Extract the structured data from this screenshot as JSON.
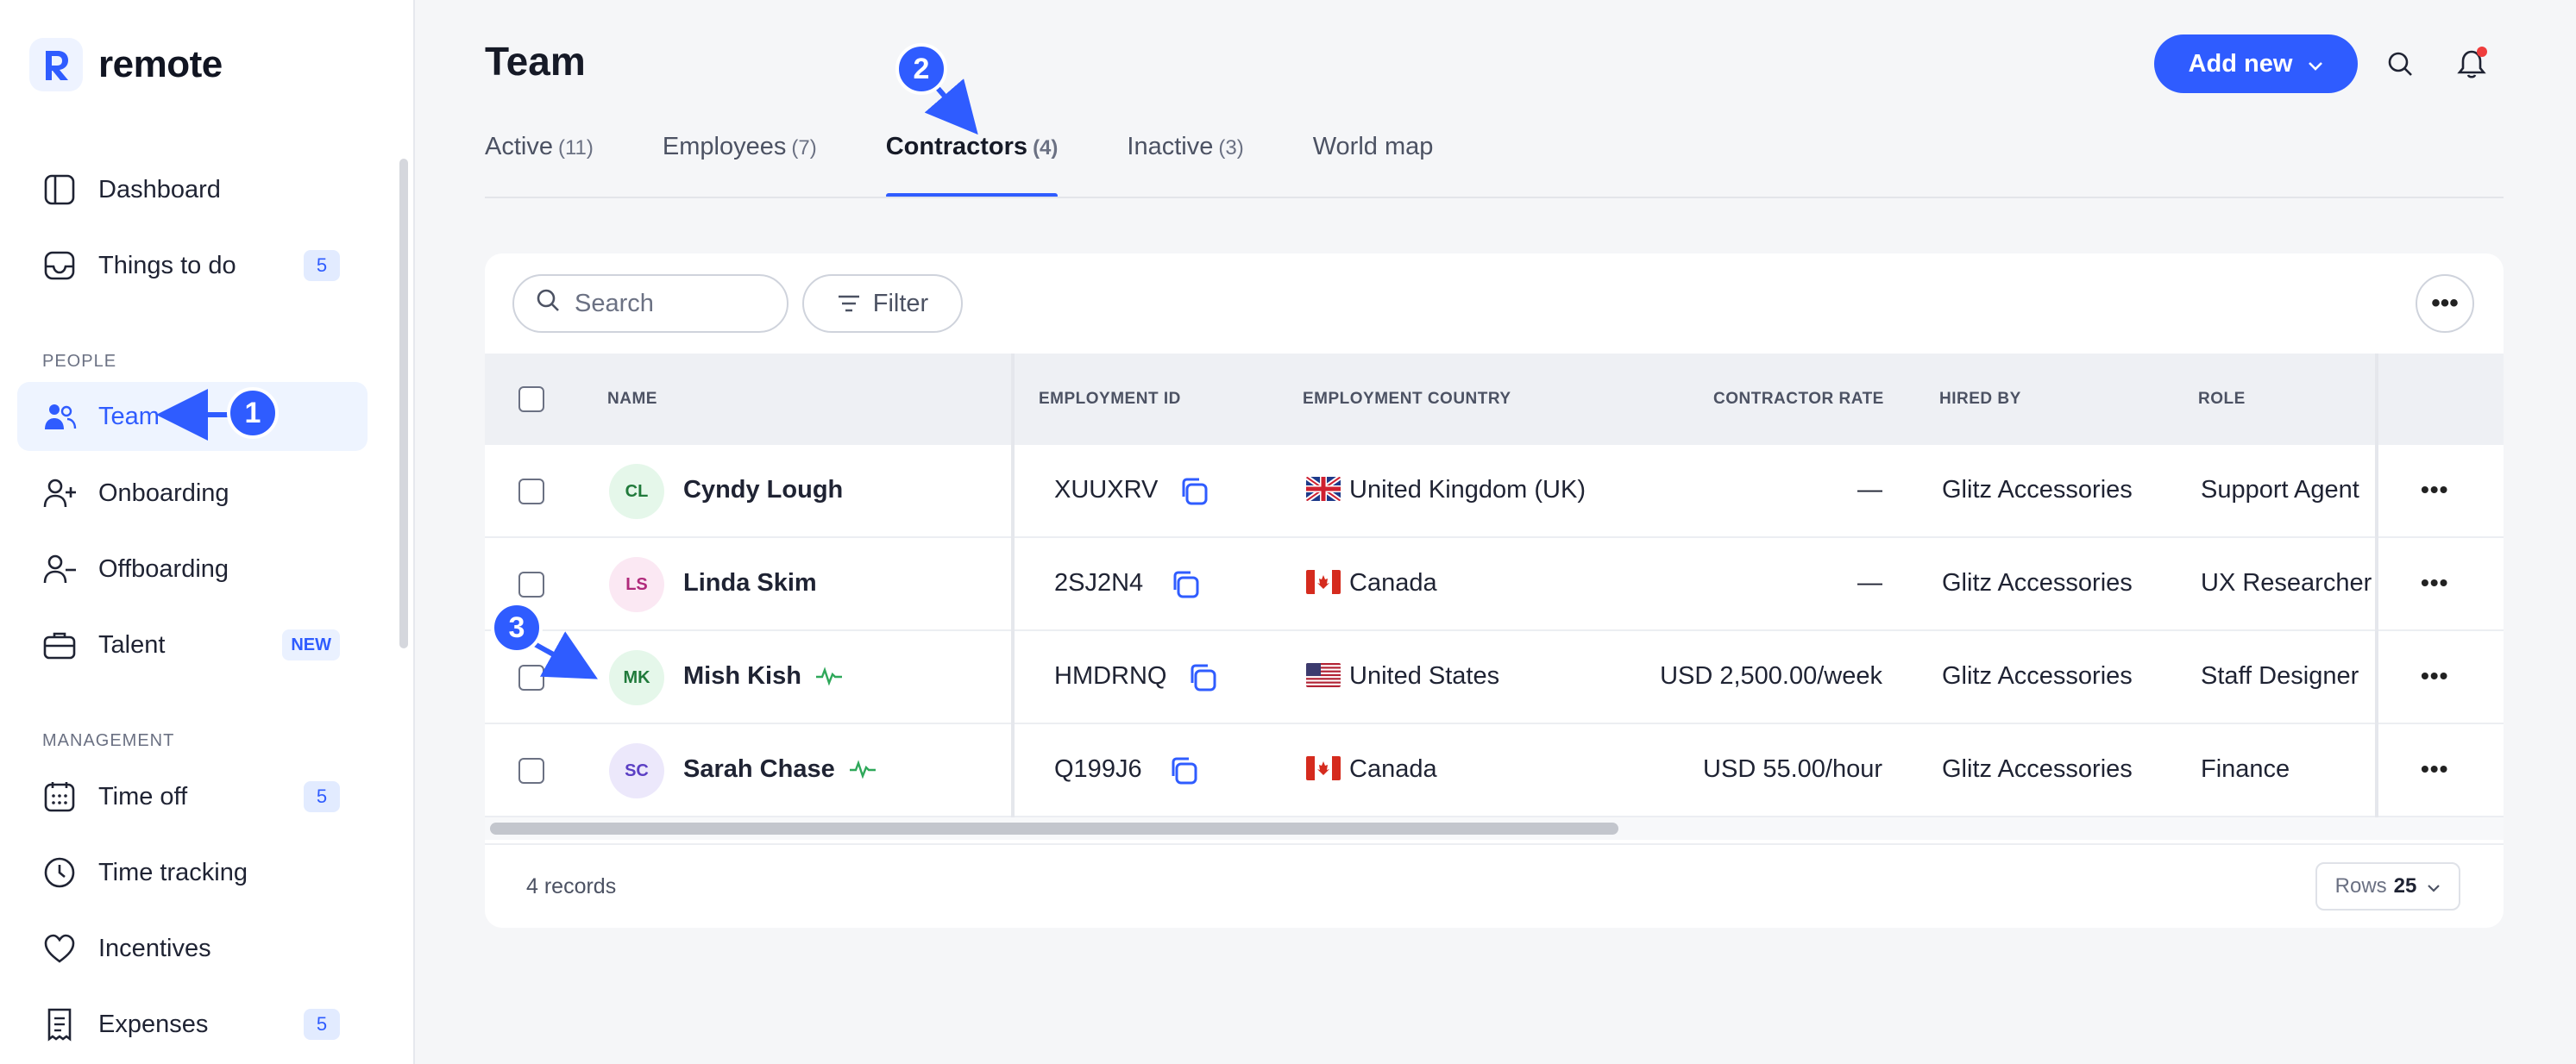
{
  "app": {
    "brand": "remote"
  },
  "sidebar": {
    "items": [
      {
        "label": "Dashboard",
        "icon": "dashboard-icon"
      },
      {
        "label": "Things to do",
        "badge": "5",
        "icon": "inbox-icon"
      },
      {
        "label": "Team",
        "icon": "team-icon",
        "active": true
      },
      {
        "label": "Onboarding",
        "icon": "user-plus-icon"
      },
      {
        "label": "Offboarding",
        "icon": "user-minus-icon"
      },
      {
        "label": "Talent",
        "badge": "NEW",
        "icon": "briefcase-icon"
      },
      {
        "label": "Time off",
        "badge": "5",
        "icon": "calendar-icon"
      },
      {
        "label": "Time tracking",
        "icon": "clock-icon"
      },
      {
        "label": "Incentives",
        "icon": "heart-icon"
      },
      {
        "label": "Expenses",
        "badge": "5",
        "icon": "receipt-icon"
      }
    ],
    "sections": {
      "people": "PEOPLE",
      "management": "MANAGEMENT"
    }
  },
  "header": {
    "title": "Team",
    "add_button": "Add new"
  },
  "tabs": [
    {
      "label": "Active",
      "count": "(11)"
    },
    {
      "label": "Employees",
      "count": "(7)"
    },
    {
      "label": "Contractors",
      "count": "(4)",
      "active": true
    },
    {
      "label": "Inactive",
      "count": "(3)"
    },
    {
      "label": "World map",
      "count": ""
    }
  ],
  "toolbar": {
    "search_placeholder": "Search",
    "filter_label": "Filter"
  },
  "table": {
    "columns": [
      "NAME",
      "EMPLOYMENT ID",
      "EMPLOYMENT COUNTRY",
      "CONTRACTOR RATE",
      "HIRED BY",
      "ROLE"
    ],
    "rows": [
      {
        "initials": "CL",
        "name": "Cyndy Lough",
        "id": "XUUXRV",
        "country": "United Kingdom (UK)",
        "flag": "uk",
        "rate": "—",
        "hired_by": "Glitz Accessories",
        "role": "Support Agent",
        "activity": false
      },
      {
        "initials": "LS",
        "name": "Linda Skim",
        "id": "2SJ2N4",
        "country": "Canada",
        "flag": "ca",
        "rate": "—",
        "hired_by": "Glitz Accessories",
        "role": "UX Researcher",
        "activity": false
      },
      {
        "initials": "MK",
        "name": "Mish Kish",
        "id": "HMDRNQ",
        "country": "United States",
        "flag": "us",
        "rate": "USD 2,500.00/week",
        "hired_by": "Glitz Accessories",
        "role": "Staff Designer",
        "activity": true
      },
      {
        "initials": "SC",
        "name": "Sarah Chase",
        "id": "Q199J6",
        "country": "Canada",
        "flag": "ca",
        "rate": "USD 55.00/hour",
        "hired_by": "Glitz Accessories",
        "role": "Finance",
        "activity": true
      }
    ]
  },
  "footer": {
    "records": "4 records",
    "rows_label": "Rows",
    "rows_value": "25"
  },
  "annotations": [
    "1",
    "2",
    "3"
  ],
  "colors": {
    "accent": "#2f5cff",
    "notification": "#ef3d3d"
  }
}
